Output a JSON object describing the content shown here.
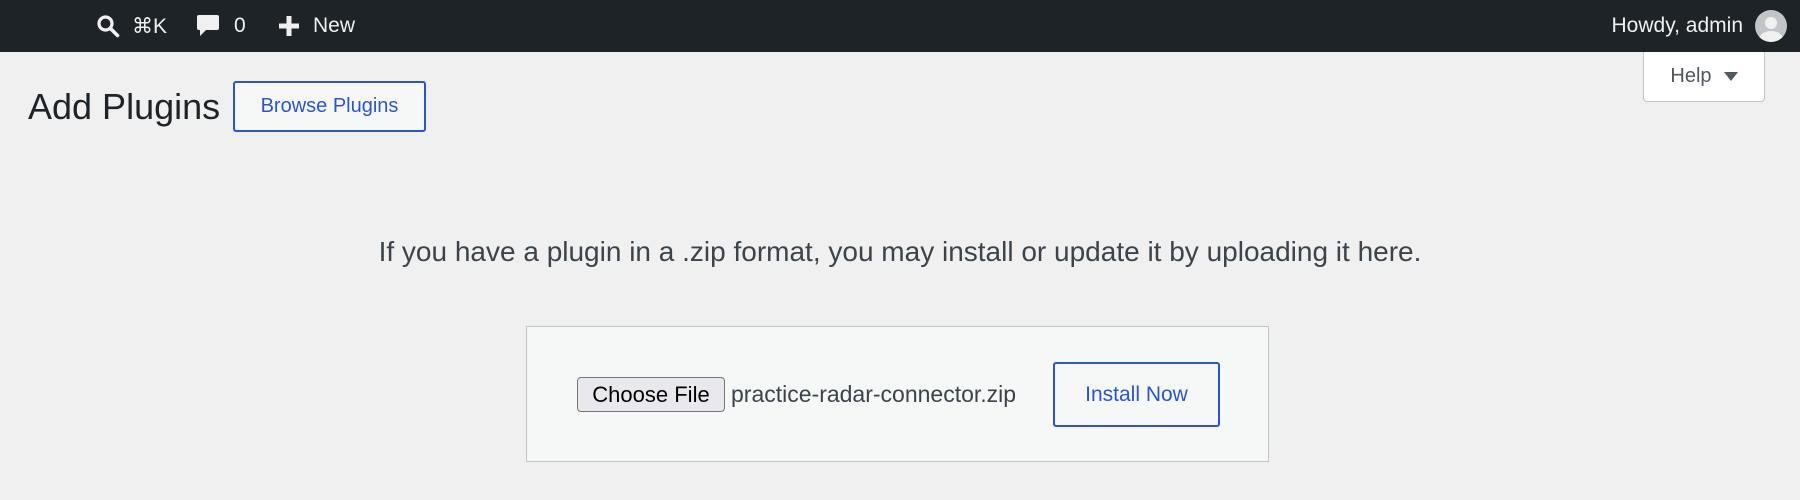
{
  "adminbar": {
    "search_shortcut": "⌘K",
    "comments_count": "0",
    "new_label": "New",
    "greeting": "Howdy, admin"
  },
  "help": {
    "label": "Help"
  },
  "page": {
    "title": "Add Plugins",
    "browse_label": "Browse Plugins"
  },
  "upload": {
    "help_text": "If you have a plugin in a .zip format, you may install or update it by uploading it here.",
    "choose_file_label": "Choose File",
    "selected_file": "practice-radar-connector.zip",
    "install_label": "Install Now"
  },
  "icons": {
    "search": "search-icon",
    "comment": "comment-icon",
    "plus": "plus-icon",
    "avatar": "avatar-icon",
    "help_caret": "caret-down-icon"
  },
  "colors": {
    "adminbar_bg": "#1d2327",
    "page_bg": "#f0f0f1",
    "accent": "#2c55c9"
  }
}
